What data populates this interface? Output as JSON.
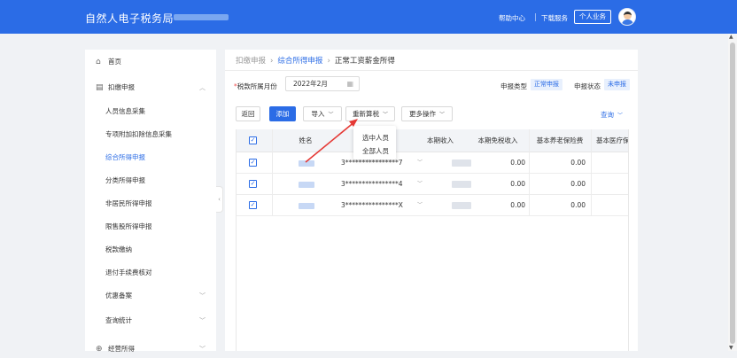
{
  "app": {
    "title": "自然人电子税务局"
  },
  "topbar": {
    "help": "帮助中心",
    "download": "下载服务",
    "personal": "个人业务"
  },
  "sidebar": {
    "items": [
      {
        "label": "首页"
      },
      {
        "label": "扣缴申报"
      },
      {
        "label": "人员信息采集"
      },
      {
        "label": "专项附加扣除信息采集"
      },
      {
        "label": "综合所得申报"
      },
      {
        "label": "分类所得申报"
      },
      {
        "label": "非居民所得申报"
      },
      {
        "label": "限售股所得申报"
      },
      {
        "label": "税款缴纳"
      },
      {
        "label": "退付手续费核对"
      },
      {
        "label": "优惠备案"
      },
      {
        "label": "查询统计"
      },
      {
        "label": "经营所得"
      }
    ]
  },
  "breadcrumb": {
    "root": "扣缴申报",
    "parent": "综合所得申报",
    "current": "正常工资薪金所得"
  },
  "form": {
    "required_mark": "*",
    "period_label": "税款所属月份",
    "period_value": "2022年2月",
    "declare_type_label": "申报类型",
    "declare_type_value": "正常申报",
    "declare_status_label": "申报状态",
    "declare_status_value": "未申报"
  },
  "toolbar": {
    "back": "返回",
    "add": "添加",
    "import": "导入",
    "recalc": "重新算税",
    "more": "更多操作",
    "query": "查询"
  },
  "recalc_menu": {
    "options": [
      "选中人员",
      "全部人员"
    ]
  },
  "table": {
    "headers": [
      "姓名",
      "本期收入",
      "本期免税收入",
      "基本养老保险费",
      "基本医疗保险"
    ],
    "rows": [
      {
        "id_no": "3****************7",
        "tax_free": "0.00",
        "pension": "0.00"
      },
      {
        "id_no": "3****************4",
        "tax_free": "0.00",
        "pension": "0.00"
      },
      {
        "id_no": "3****************X",
        "tax_free": "0.00",
        "pension": "0.00"
      }
    ]
  },
  "colors": {
    "brand": "#2b6ce6",
    "annotation_arrow": "#e53935"
  }
}
